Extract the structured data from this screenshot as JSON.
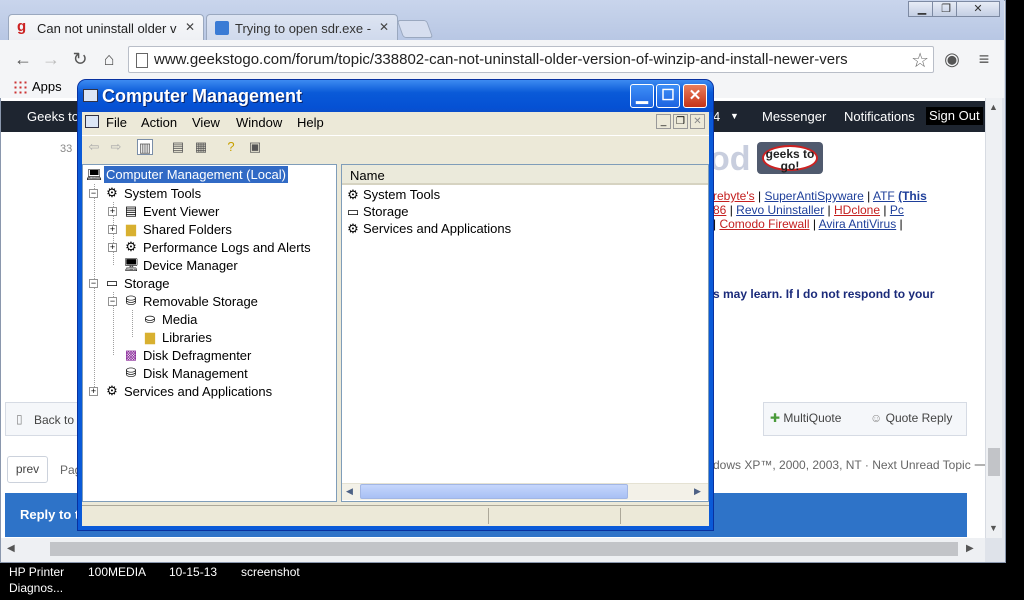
{
  "browser": {
    "tabs": [
      {
        "title": "Can not uninstall older v",
        "close": "✕"
      },
      {
        "title": "Trying to open sdr.exe -",
        "close": "✕"
      }
    ],
    "url": "www.geekstogo.com/forum/topic/338802-can-not-uninstall-older-version-of-winzip-and-install-newer-vers",
    "bookmarks": {
      "apps_label": "Apps"
    }
  },
  "site": {
    "nav_left": "Geeks to",
    "nav_partial": "4",
    "nav_items": [
      "Messenger",
      "Notifications",
      "Sign Out"
    ],
    "badge": "33",
    "logo_text": "geeks to go!",
    "partial_od": "od",
    "links_line1": [
      "rebyte's",
      "SuperAntiSpyware",
      "ATF",
      "(This"
    ],
    "links_line2": [
      "86",
      "Revo Uninstaller",
      "HDclone",
      "Pc"
    ],
    "links_line3": [
      "Comodo Firewall",
      "Avira AntiVirus"
    ],
    "bold_text": "s may learn. If I do not respond to your",
    "back_label": "Back to",
    "multiquote_label": "MultiQuote",
    "quote_reply_label": "Quote Reply",
    "prev_label": "prev",
    "page_partial": "Pag",
    "footer_text": "dows XP™, 2000, 2003, NT · Next Unread Topic ⟶",
    "reply_partial": "Reply to t"
  },
  "mmc": {
    "title": "Computer Management",
    "menu": [
      "File",
      "Action",
      "View",
      "Window",
      "Help"
    ],
    "tree": {
      "root": "Computer Management (Local)",
      "system_tools": "System Tools",
      "event_viewer": "Event Viewer",
      "shared_folders": "Shared Folders",
      "perf_logs": "Performance Logs and Alerts",
      "device_manager": "Device Manager",
      "storage": "Storage",
      "removable_storage": "Removable Storage",
      "media": "Media",
      "libraries": "Libraries",
      "disk_defrag": "Disk Defragmenter",
      "disk_management": "Disk Management",
      "services_apps": "Services and Applications"
    },
    "list_header": "Name",
    "list_items": [
      "System Tools",
      "Storage",
      "Services and Applications"
    ]
  },
  "desktop": {
    "items": [
      "HP Printer",
      "100MEDIA",
      "10-15-13",
      "screenshot"
    ],
    "second_line": "Diagnos..."
  }
}
